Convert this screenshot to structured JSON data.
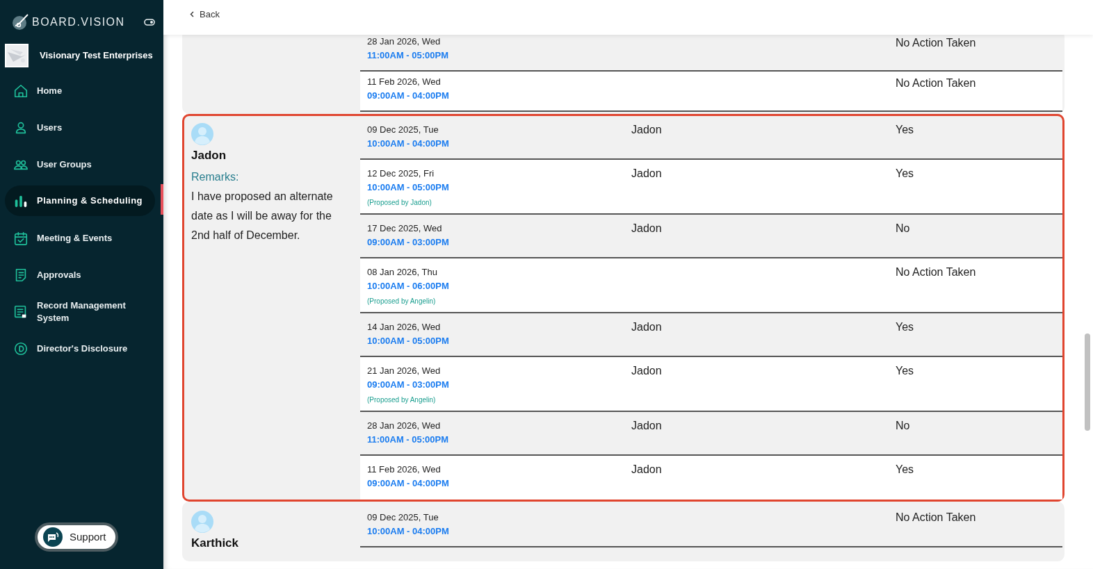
{
  "sidebar": {
    "brand": "BOARD.VISION",
    "organization": "Visionary Test Enterprises",
    "items": [
      {
        "label": "Home",
        "kind": "home",
        "selected": false
      },
      {
        "label": "Users",
        "kind": "user",
        "selected": false
      },
      {
        "label": "User Groups",
        "kind": "users",
        "selected": false
      },
      {
        "label": "Planning & Scheduling",
        "kind": "chart",
        "selected": true
      },
      {
        "label": "Meeting & Events",
        "kind": "calendar",
        "selected": false
      },
      {
        "label": "Approvals",
        "kind": "document",
        "selected": false
      },
      {
        "label": "Record Management System",
        "kind": "record",
        "selected": false
      },
      {
        "label": "Director's Disclosure",
        "kind": "letter",
        "selected": false
      }
    ],
    "support": "Support"
  },
  "header": {
    "back": "Back"
  },
  "groups": [
    {
      "highlighted": false,
      "slots": [
        {
          "date": "28 Jan 2026, Wed",
          "time": "11:00AM - 05:00PM",
          "response": "No Action Taken"
        },
        {
          "date": "11 Feb 2026, Wed",
          "time": "09:00AM - 04:00PM",
          "response": "No Action Taken"
        }
      ]
    },
    {
      "highlighted": true,
      "participant": {
        "name": "Jadon",
        "remarks_label": "Remarks:",
        "remarks": "I have proposed an alternate date as I will be away for the 2nd half of December."
      },
      "slots": [
        {
          "date": "09 Dec 2025, Tue",
          "time": "10:00AM - 04:00PM",
          "responder": "Jadon",
          "response": "Yes"
        },
        {
          "date": "12 Dec 2025, Fri",
          "time": "10:00AM - 05:00PM",
          "proposed": "(Proposed by Jadon)",
          "responder": "Jadon",
          "response": "Yes"
        },
        {
          "date": "17 Dec 2025, Wed",
          "time": "09:00AM - 03:00PM",
          "responder": "Jadon",
          "response": "No"
        },
        {
          "date": "08 Jan 2026, Thu",
          "time": "10:00AM - 06:00PM",
          "proposed": "(Proposed by Angelin)",
          "response": "No Action Taken"
        },
        {
          "date": "14 Jan 2026, Wed",
          "time": "10:00AM - 05:00PM",
          "responder": "Jadon",
          "response": "Yes"
        },
        {
          "date": "21 Jan 2026, Wed",
          "time": "09:00AM - 03:00PM",
          "proposed": "(Proposed by Angelin)",
          "responder": "Jadon",
          "response": "Yes"
        },
        {
          "date": "28 Jan 2026, Wed",
          "time": "11:00AM - 05:00PM",
          "responder": "Jadon",
          "response": "No"
        },
        {
          "date": "11 Feb 2026, Wed",
          "time": "09:00AM - 04:00PM",
          "responder": "Jadon",
          "response": "Yes"
        }
      ]
    },
    {
      "highlighted": false,
      "participant": {
        "name": "Karthick"
      },
      "slots": [
        {
          "date": "09 Dec 2025, Tue",
          "time": "10:00AM - 04:00PM",
          "response": "No Action Taken"
        }
      ]
    }
  ]
}
